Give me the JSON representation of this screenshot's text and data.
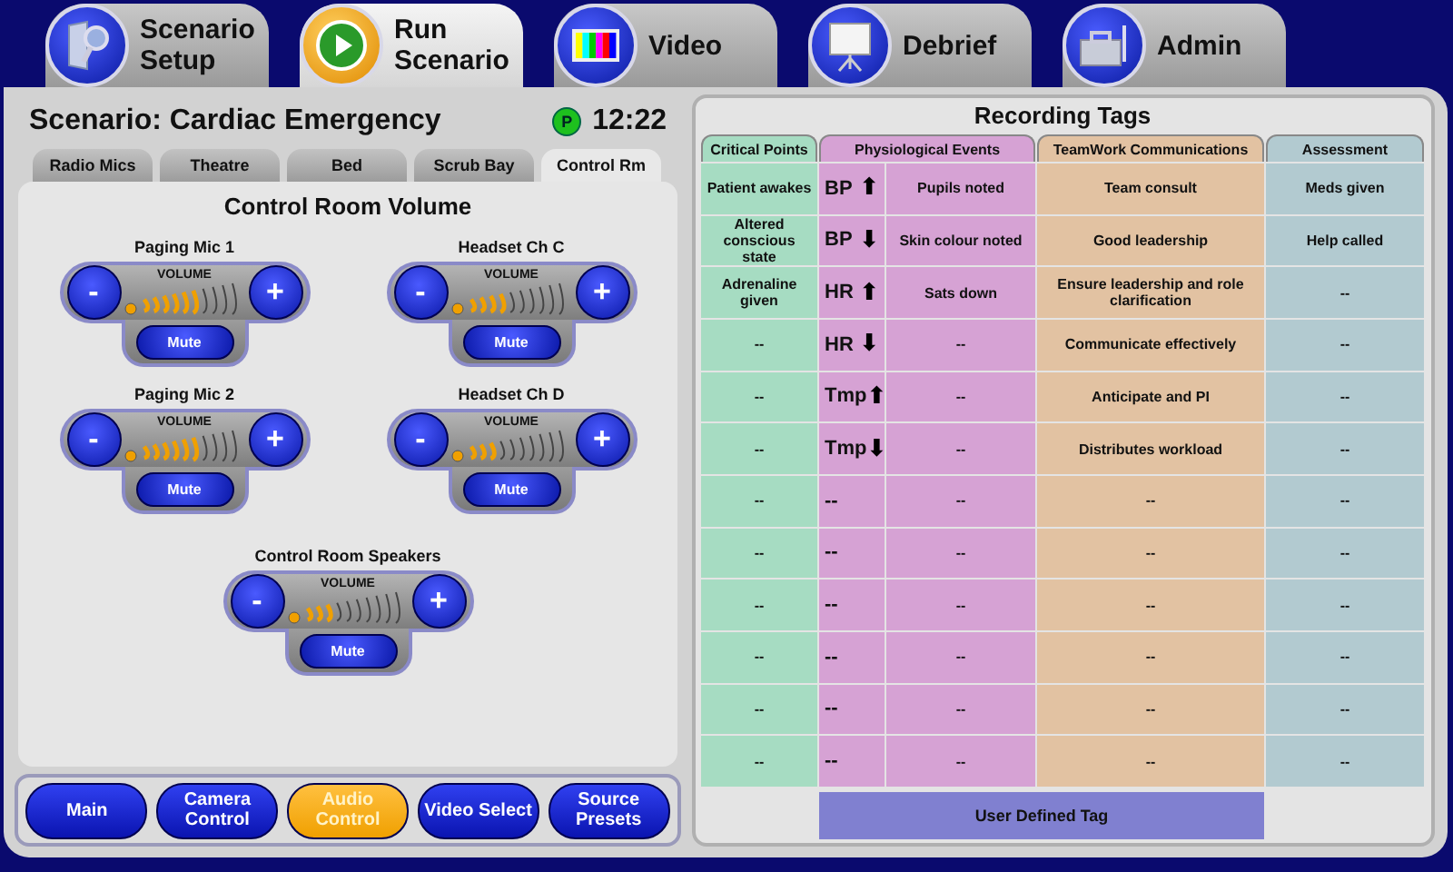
{
  "main_tabs": [
    {
      "label": "Scenario Setup",
      "selected": false
    },
    {
      "label": "Run Scenario",
      "selected": true
    },
    {
      "label": "Video",
      "selected": false
    },
    {
      "label": "Debrief",
      "selected": false
    },
    {
      "label": "Admin",
      "selected": false
    }
  ],
  "scenario": {
    "title": "Scenario: Cardiac Emergency",
    "status": "P",
    "time": "12:22"
  },
  "room_tabs": [
    {
      "label": "Radio Mics",
      "selected": false
    },
    {
      "label": "Theatre",
      "selected": false
    },
    {
      "label": "Bed",
      "selected": false
    },
    {
      "label": "Scrub Bay",
      "selected": false
    },
    {
      "label": "Control Rm",
      "selected": true
    }
  ],
  "volume_panel": {
    "title": "Control Room Volume",
    "channels": [
      {
        "name": "Paging Mic 1",
        "volume_label": "VOLUME",
        "minus": "-",
        "plus": "+",
        "mute": "Mute",
        "level": 0.64
      },
      {
        "name": "Headset Ch C",
        "volume_label": "VOLUME",
        "minus": "-",
        "plus": "+",
        "mute": "Mute",
        "level": 0.45
      },
      {
        "name": "Paging Mic 2",
        "volume_label": "VOLUME",
        "minus": "-",
        "plus": "+",
        "mute": "Mute",
        "level": 0.64
      },
      {
        "name": "Headset Ch D",
        "volume_label": "VOLUME",
        "minus": "-",
        "plus": "+",
        "mute": "Mute",
        "level": 0.36
      },
      {
        "name": "Control Room Speakers",
        "volume_label": "VOLUME",
        "minus": "-",
        "plus": "+",
        "mute": "Mute",
        "level": 0.36
      }
    ]
  },
  "nav_buttons": [
    {
      "label": "Main",
      "selected": false
    },
    {
      "label": "Camera Control",
      "selected": false
    },
    {
      "label": "Audio Control",
      "selected": true
    },
    {
      "label": "Video Select",
      "selected": false
    },
    {
      "label": "Source Presets",
      "selected": false
    }
  ],
  "recording_tags": {
    "title": "Recording Tags",
    "columns": [
      {
        "label": "Critical Points",
        "color": "#a6dcc2"
      },
      {
        "label": "Physiological Events",
        "color": "#d6a2d4"
      },
      {
        "label": "TeamWork Communications",
        "color": "#e2c2a2"
      },
      {
        "label": "Assessment",
        "color": "#b2cad0"
      }
    ],
    "rows": [
      {
        "critical": "Patient awakes",
        "vital": "BP",
        "arrow": "⬆",
        "event": "Pupils noted",
        "teamwork": "Team consult",
        "assessment": "Meds given"
      },
      {
        "critical": "Altered conscious state",
        "vital": "BP",
        "arrow": "⬇",
        "event": "Skin colour noted",
        "teamwork": "Good leadership",
        "assessment": "Help called"
      },
      {
        "critical": "Adrenaline given",
        "vital": "HR",
        "arrow": "⬆",
        "event": "Sats down",
        "teamwork": "Ensure leadership and role clarification",
        "assessment": "--"
      },
      {
        "critical": "--",
        "vital": "HR",
        "arrow": "⬇",
        "event": "--",
        "teamwork": "Communicate effectively",
        "assessment": "--"
      },
      {
        "critical": "--",
        "vital": "Tmp",
        "arrow": "⬆",
        "event": "--",
        "teamwork": "Anticipate and PI",
        "assessment": "--"
      },
      {
        "critical": "--",
        "vital": "Tmp",
        "arrow": "⬇",
        "event": "--",
        "teamwork": "Distributes workload",
        "assessment": "--"
      },
      {
        "critical": "--",
        "vital": "--",
        "event": "--",
        "teamwork": "--",
        "assessment": "--"
      },
      {
        "critical": "--",
        "vital": "--",
        "event": "--",
        "teamwork": "--",
        "assessment": "--"
      },
      {
        "critical": "--",
        "vital": "--",
        "event": "--",
        "teamwork": "--",
        "assessment": "--"
      },
      {
        "critical": "--",
        "vital": "--",
        "event": "--",
        "teamwork": "--",
        "assessment": "--"
      },
      {
        "critical": "--",
        "vital": "--",
        "event": "--",
        "teamwork": "--",
        "assessment": "--"
      },
      {
        "critical": "--",
        "vital": "--",
        "event": "--",
        "teamwork": "--",
        "assessment": "--"
      }
    ],
    "user_defined": "User Defined Tag"
  }
}
